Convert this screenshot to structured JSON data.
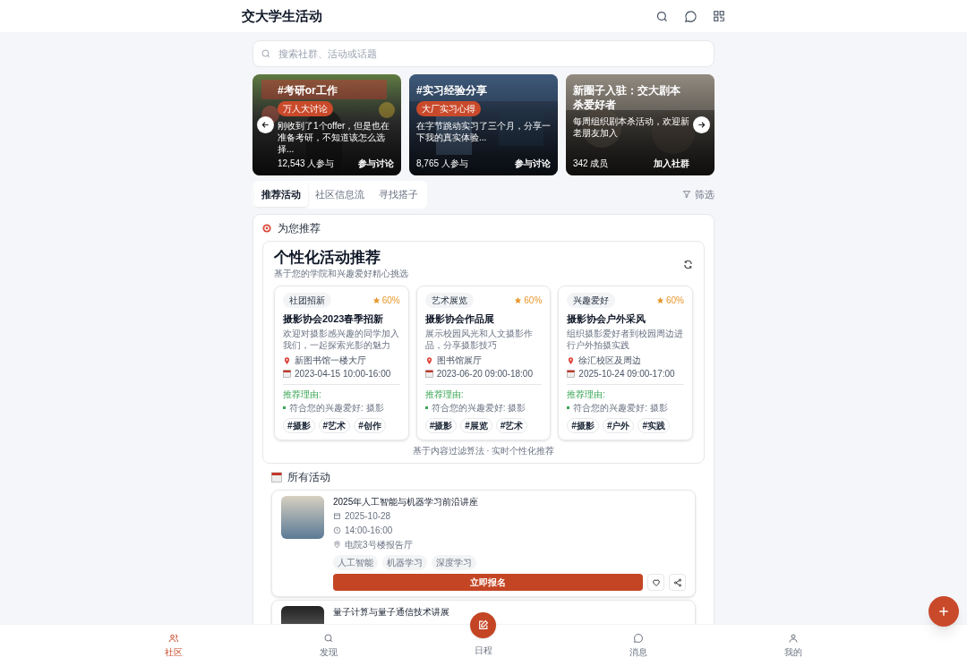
{
  "header": {
    "title": "交大学生活动"
  },
  "search": {
    "placeholder": "搜索社群、活动或话题"
  },
  "banners": [
    {
      "title": "#考研or工作",
      "badge": "万人大讨论",
      "text": "刚收到了1个offer，但是也在准备考研，不知道该怎么选择...",
      "count": "12,543 人参与",
      "action": "参与讨论"
    },
    {
      "title": "#实习经验分享",
      "badge": "大厂实习心得",
      "text": "在字节跳动实习了三个月，分享一下我的真实体验...",
      "count": "8,765 人参与",
      "action": "参与讨论"
    },
    {
      "title": "新圈子入驻：交大剧本杀爱好者",
      "text": "每周组织剧本杀活动，欢迎新老朋友加入",
      "count": "342 成员",
      "action": "加入社群"
    }
  ],
  "tabs": [
    {
      "label": "推荐活动",
      "selected": true
    },
    {
      "label": "社区信息流",
      "selected": false
    },
    {
      "label": "寻找搭子",
      "selected": false
    }
  ],
  "filter": {
    "label": "筛选"
  },
  "recommend": {
    "heading": "为您推荐",
    "title": "个性化活动推荐",
    "subtitle": "基于您的学院和兴趣爱好精心挑选",
    "footer": "基于内容过滤算法 · 实时个性化推荐",
    "cards": [
      {
        "category": "社团招新",
        "score": "60%",
        "title": "摄影协会2023春季招新",
        "desc": "欢迎对摄影感兴趣的同学加入我们，一起探索光影的魅力",
        "place": "新图书馆一楼大厅",
        "time": "2023-04-15 10:00-16:00",
        "reason_label": "推荐理由:",
        "reasons": [
          "符合您的兴趣爱好: 摄影"
        ],
        "tags": [
          "#摄影",
          "#艺术",
          "#创作"
        ]
      },
      {
        "category": "艺术展览",
        "score": "60%",
        "title": "摄影协会作品展",
        "desc": "展示校园风光和人文摄影作品，分享摄影技巧",
        "place": "图书馆展厅",
        "time": "2023-06-20 09:00-18:00",
        "reason_label": "推荐理由:",
        "reasons": [
          "符合您的兴趣爱好: 摄影"
        ],
        "tags": [
          "#摄影",
          "#展览",
          "#艺术"
        ]
      },
      {
        "category": "兴趣爱好",
        "score": "60%",
        "title": "摄影协会户外采风",
        "desc": "组织摄影爱好者到校园周边进行户外拍摄实践",
        "place": "徐汇校区及周边",
        "time": "2025-10-24 09:00-17:00",
        "reason_label": "推荐理由:",
        "reasons": [
          "符合您的兴趣爱好: 摄影"
        ],
        "tags": [
          "#摄影",
          "#户外",
          "#实践"
        ]
      }
    ]
  },
  "activities": {
    "heading": "所有活动",
    "items": [
      {
        "title": "2025年人工智能与机器学习前沿讲座",
        "date": "2025-10-28",
        "time": "14:00-16:00",
        "place": "电院3号楼报告厅",
        "tags": [
          "人工智能",
          "机器学习",
          "深度学习"
        ],
        "action": "立即报名"
      },
      {
        "title": "量子计算与量子通信技术讲展"
      }
    ]
  },
  "bottom_nav": [
    {
      "label": "社区",
      "selected": true
    },
    {
      "label": "发现",
      "selected": false
    },
    {
      "label": "日程",
      "kind": "center",
      "selected": false
    },
    {
      "label": "消息",
      "selected": false
    },
    {
      "label": "我的",
      "selected": false
    }
  ]
}
